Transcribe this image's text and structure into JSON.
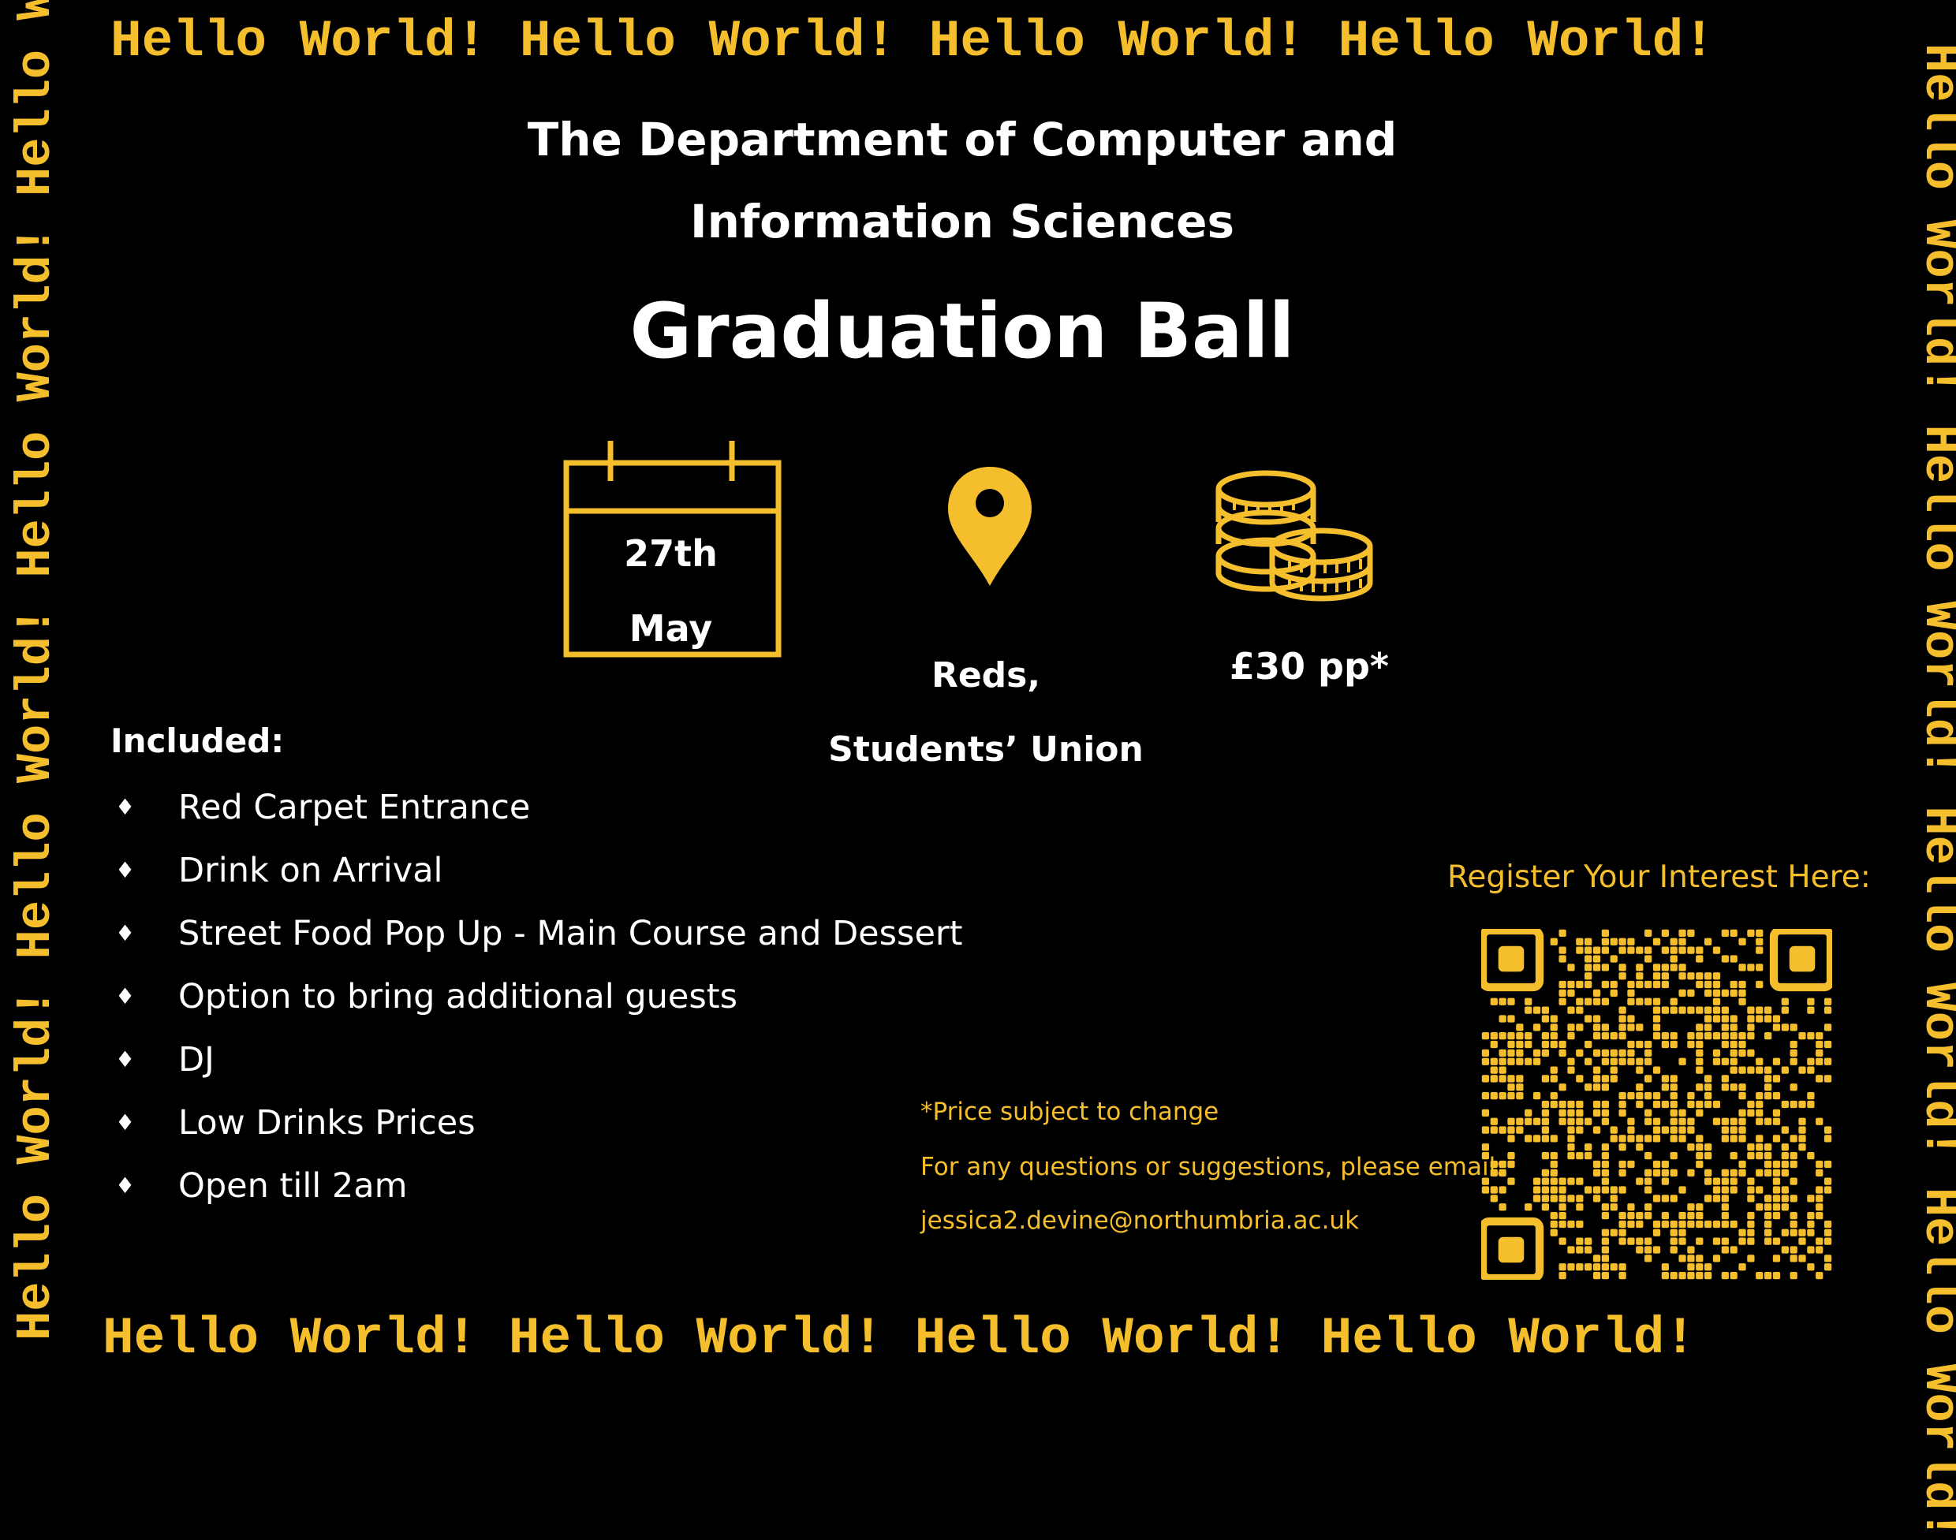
{
  "border_text": {
    "top": "Hello World! Hello World! Hello World! Hello World!",
    "bottom": "Hello World! Hello World! Hello World! Hello World!",
    "left": "Hello World! Hello World! Hello World! Hello World!",
    "right": "Hello World! Hello World! Hello World! Hello World!"
  },
  "department": {
    "line1": "The Department of Computer and",
    "line2": "Information Sciences"
  },
  "title": "Graduation Ball",
  "date": {
    "day": "27th",
    "month": "May",
    "icon": "calendar-icon"
  },
  "venue": {
    "line1": "Reds,",
    "line2": "Students’ Union",
    "icon": "map-pin-icon"
  },
  "price": {
    "text": "£30 pp*",
    "icon": "coins-icon"
  },
  "included": {
    "heading": "Included:",
    "bullet": "♦",
    "items": [
      "Red Carpet Entrance",
      "Drink on Arrival",
      "Street Food Pop Up - Main Course and Dessert",
      "Option to bring additional guests",
      "DJ",
      "Low Drinks Prices",
      "Open till 2am"
    ]
  },
  "notes": {
    "price_note": "*Price subject to change",
    "contact_prompt": "For any questions or suggestions, please email:",
    "email": "jessica2.devine@northumbria.ac.uk"
  },
  "register": {
    "label": "Register Your Interest Here:",
    "qr": "qr-code"
  },
  "colors": {
    "background": "#000000",
    "accent": "#f5be2c",
    "text": "#ffffff"
  }
}
